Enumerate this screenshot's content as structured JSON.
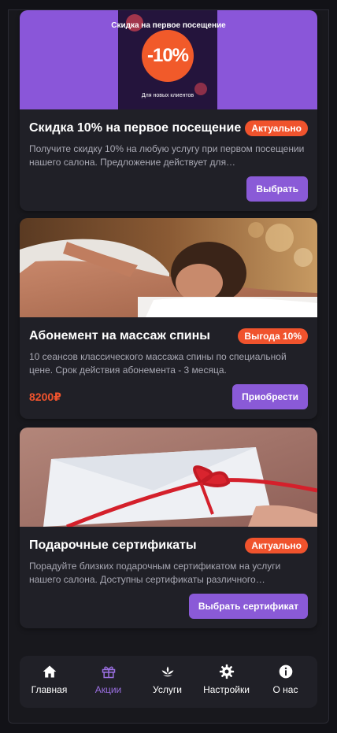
{
  "cards": [
    {
      "image_text_top": "Скидка на первое посещение",
      "image_text_main": "-10%",
      "image_text_bottom": "Для новых клиентов",
      "title": "Скидка 10% на первое посещение",
      "badge": "Актуально",
      "description": "Получите скидку 10% на любую услугу при первом посещении нашего салона. Предложение действует для…",
      "button": "Выбрать"
    },
    {
      "title": "Абонемент на массаж спины",
      "badge": "Выгода 10%",
      "description": "10 сеансов классического массажа спины по специальной цене. Срок действия абонемента - 3 месяца.",
      "price": "8200₽",
      "button": "Приобрести"
    },
    {
      "title": "Подарочные сертификаты",
      "badge": "Актуально",
      "description": "Порадуйте близких подарочным сертификатом на услуги нашего салона. Доступны сертификаты различного…",
      "button": "Выбрать сертификат"
    }
  ],
  "nav": {
    "items": [
      {
        "label": "Главная",
        "icon": "home-icon"
      },
      {
        "label": "Акции",
        "icon": "gift-icon",
        "active": true
      },
      {
        "label": "Услуги",
        "icon": "lotus-icon"
      },
      {
        "label": "Настройки",
        "icon": "gear-icon"
      },
      {
        "label": "О нас",
        "icon": "info-icon"
      }
    ]
  },
  "colors": {
    "accent": "#8a5ad7",
    "badge": "#f0532d",
    "price": "#f0532d",
    "active_nav": "#9a6fe0"
  }
}
